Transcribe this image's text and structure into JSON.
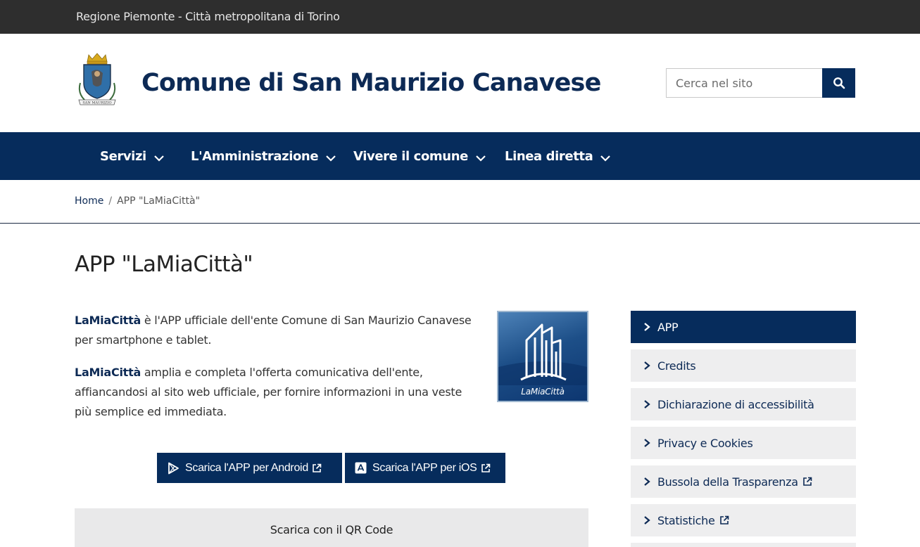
{
  "topbar": {
    "text": "Regione Piemonte - Città metropolitana di Torino"
  },
  "header": {
    "title": "Comune di San Maurizio Canavese",
    "logo_icon": "coat-of-arms",
    "logo_text": "SAN MAURIZIO",
    "search": {
      "placeholder": "Cerca nel sito",
      "button_icon": "search-icon"
    }
  },
  "nav": {
    "items": [
      {
        "label": "Servizi"
      },
      {
        "label": "L'Amministrazione"
      },
      {
        "label": "Vivere il comune"
      },
      {
        "label": "Linea diretta"
      }
    ]
  },
  "breadcrumb": {
    "home": "Home",
    "separator": "/",
    "current": "APP \"LaMiaCittà\""
  },
  "main": {
    "title": "APP \"LaMiaCittà\"",
    "para1": {
      "brand": "LaMiaCittà",
      "text": " è l'APP ufficiale dell'ente Comune di San Maurizio Canavese per smartphone e tablet."
    },
    "para2": {
      "brand": "LaMiaCittà",
      "text": " amplia e completa l'offerta comunicativa dell'ente, affiancandosi al sito web ufficiale, per fornire informazioni in una veste più semplice ed immediata."
    },
    "app_logo_text": "LaMiaCittà",
    "buttons": {
      "android": "Scarica l'APP per Android",
      "ios": "Scarica l'APP per iOS"
    },
    "qr": {
      "label": "Scarica con il QR Code"
    }
  },
  "sidebar": {
    "items": [
      {
        "label": "APP"
      },
      {
        "label": "Credits"
      },
      {
        "label": "Dichiarazione di accessibilità"
      },
      {
        "label": "Privacy e Cookies"
      },
      {
        "label": "Bussola della Trasparenza"
      },
      {
        "label": "Statistiche"
      }
    ]
  },
  "colors": {
    "brand": "#062c5c",
    "title": "#0d2a55",
    "topbar": "#2e2e2e",
    "sidebar_bg": "#eeeeef"
  }
}
